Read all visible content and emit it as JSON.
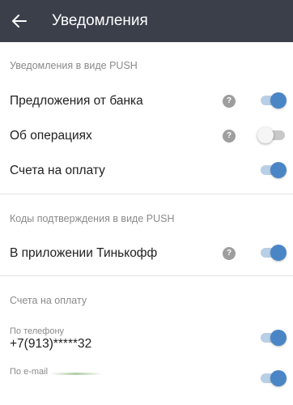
{
  "appbar": {
    "title": "Уведомления",
    "back_icon": "arrow-left-icon"
  },
  "sections": [
    {
      "header": "Уведомления в виде PUSH",
      "rows": [
        {
          "label": "Предложения от банка",
          "help": "?",
          "enabled": true
        },
        {
          "label": "Об операциях",
          "help": "?",
          "enabled": false
        },
        {
          "label": "Счета на оплату",
          "enabled": true
        }
      ]
    },
    {
      "header": "Коды подтверждения в виде PUSH",
      "rows": [
        {
          "label": "В приложении Тинькофф",
          "help": "?",
          "enabled": true
        }
      ]
    },
    {
      "header": "Счета на оплату",
      "rows": [
        {
          "label": "По телефону",
          "value": "+7(913)*****32",
          "enabled": true
        },
        {
          "label": "По e-mail",
          "enabled": true
        }
      ]
    }
  ],
  "colors": {
    "appbar": "#3b3f4a",
    "accent": "#4a86c6",
    "accent_track": "#b8cfe6",
    "secondary_text": "#8a8a8a"
  }
}
